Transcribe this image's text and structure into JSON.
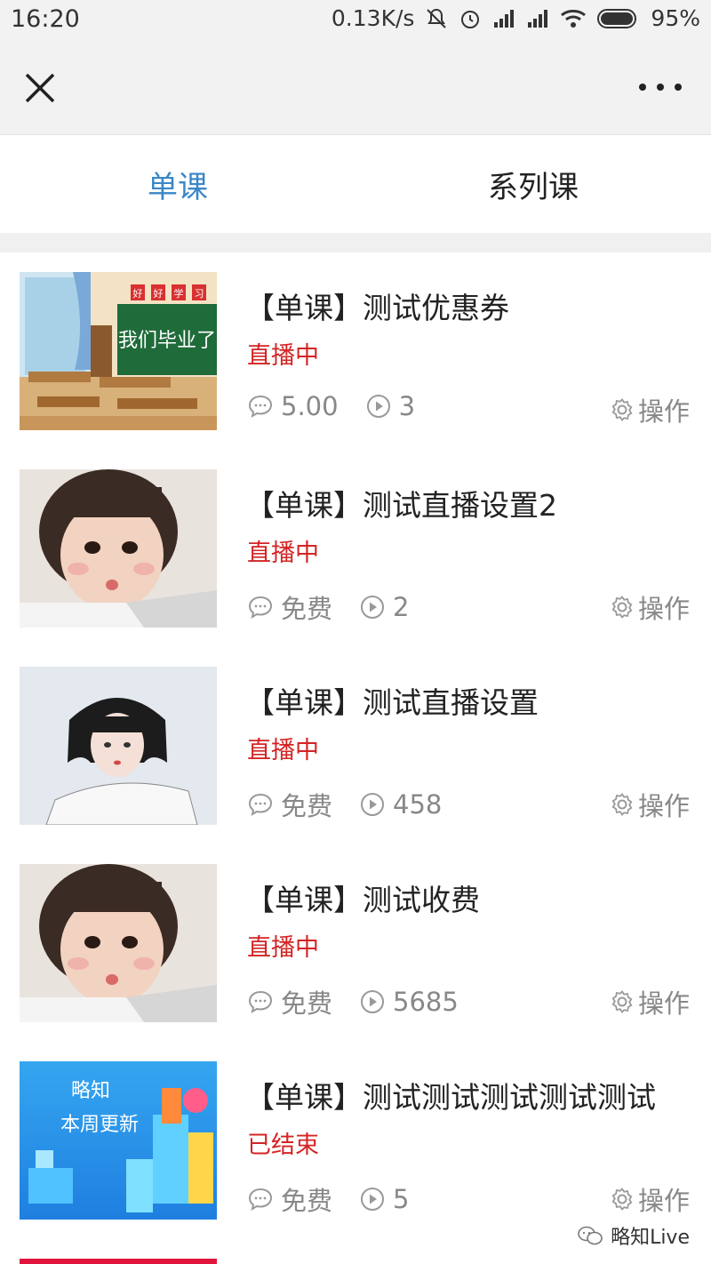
{
  "status_bar": {
    "time": "16:20",
    "network_speed": "0.13K/s",
    "battery": "95%"
  },
  "nav": {
    "close_icon": "close-icon",
    "more_icon": "more-dots-icon"
  },
  "tabs": [
    {
      "label": "单课",
      "active": true
    },
    {
      "label": "系列课",
      "active": false
    }
  ],
  "colors": {
    "accent": "#3a86c8",
    "live_red": "#d42424",
    "meta_gray": "#888888"
  },
  "courses": [
    {
      "title": "【单课】测试优惠券",
      "status": "直播中",
      "price": "5.00",
      "plays": "3",
      "action": "操作",
      "thumb_text": "我们毕业了",
      "thumb_flags": [
        "好",
        "好",
        "学",
        "习"
      ]
    },
    {
      "title": "【单课】测试直播设置2",
      "status": "直播中",
      "price": "免费",
      "plays": "2",
      "action": "操作"
    },
    {
      "title": "【单课】测试直播设置",
      "status": "直播中",
      "price": "免费",
      "plays": "458",
      "action": "操作"
    },
    {
      "title": "【单课】测试收费",
      "status": "直播中",
      "price": "免费",
      "plays": "5685",
      "action": "操作"
    },
    {
      "title": "【单课】测试测试测试测试测试",
      "status": "已结束",
      "price": "免费",
      "plays": "5",
      "action": "操作",
      "thumb_text_1": "略知",
      "thumb_text_2": "本周更新"
    }
  ],
  "watermark": "略知Live"
}
